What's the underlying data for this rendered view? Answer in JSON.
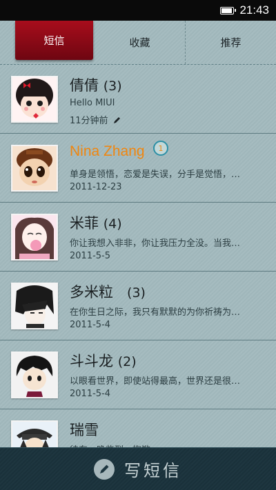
{
  "status_bar": {
    "time": "21:43",
    "battery_level": 1.0
  },
  "tabs": [
    {
      "label": "短信",
      "active": true
    },
    {
      "label": "收藏",
      "active": false
    },
    {
      "label": "推荐",
      "active": false
    }
  ],
  "conversations": [
    {
      "name": "倩倩",
      "count": "(3)",
      "snippet": "Hello MIUI",
      "date": "11分钟前",
      "draft": true
    },
    {
      "name": "Nina Zhang",
      "unread": "1",
      "snippet": "单身是领悟，恋爱是失误，分手是觉悟，…",
      "date": "2011-12-23"
    },
    {
      "name": "米菲",
      "count": "(4)",
      "snippet": "你让我想入非非，你让我压力全没。当我…",
      "date": "2011-5-5"
    },
    {
      "name": "多米粒",
      "count": "(3)",
      "snippet": "在你生日之际，我只有默默的为你祈祷为…",
      "date": "2011-5-4"
    },
    {
      "name": "斗斗龙",
      "count": "(2)",
      "snippet": "以眼看世界，即使站得最高，世界还是很…",
      "date": "2011-5-4"
    },
    {
      "name": "瑞雪",
      "snippet": "待东，晚些到，抱歉",
      "date": ""
    }
  ],
  "compose": {
    "label": "写短信",
    "icon": "pencil-bubble-icon"
  },
  "colors": {
    "accent": "#8e0a17",
    "highlight_name": "#f0860f",
    "bottom_bar": "#1e3640"
  }
}
